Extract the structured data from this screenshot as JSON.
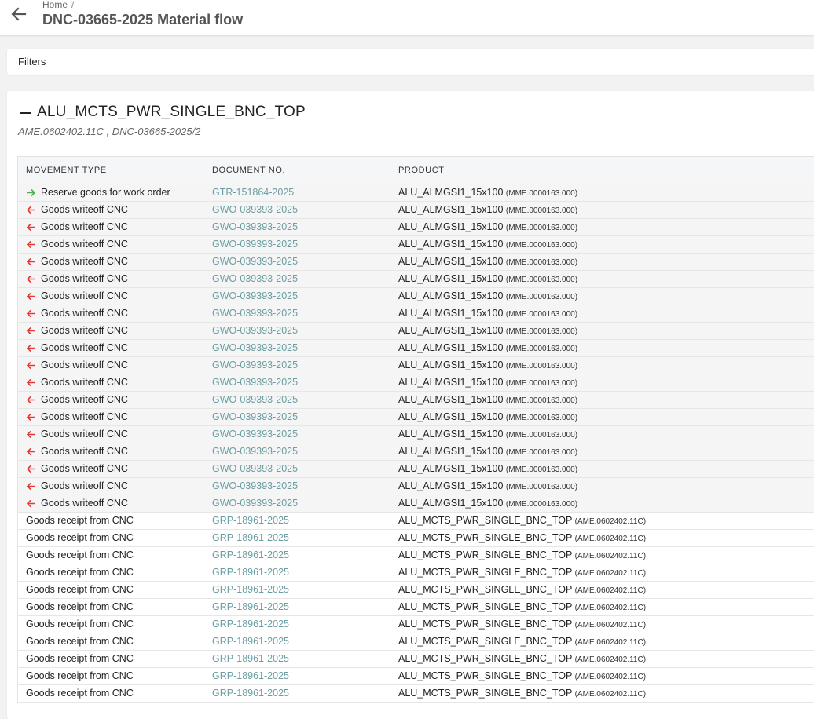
{
  "header": {
    "breadcrumb_home": "Home",
    "breadcrumb_sep": "/",
    "title": "DNC-03665-2025 Material flow"
  },
  "filters": {
    "label": "Filters"
  },
  "group": {
    "title": "ALU_MCTS_PWR_SINGLE_BNC_TOP",
    "subtitle": "AME.0602402.11C , DNC-03665-2025/2"
  },
  "colors": {
    "arrow_in": "#4caf50",
    "arrow_out": "#e53935",
    "link": "#6b9ea3"
  },
  "table": {
    "columns": [
      "MOVEMENT TYPE",
      "DOCUMENT NO.",
      "PRODUCT"
    ],
    "rows": [
      {
        "icon": "arrow-right-icon",
        "type": "Reserve goods for work order",
        "doc": "GTR-151864-2025",
        "product": "ALU_ALMGSI1_15x100",
        "code": "(MME.0000163.000)"
      },
      {
        "icon": "arrow-left-icon",
        "type": "Goods writeoff CNC",
        "doc": "GWO-039393-2025",
        "product": "ALU_ALMGSI1_15x100",
        "code": "(MME.0000163.000)"
      },
      {
        "icon": "arrow-left-icon",
        "type": "Goods writeoff CNC",
        "doc": "GWO-039393-2025",
        "product": "ALU_ALMGSI1_15x100",
        "code": "(MME.0000163.000)"
      },
      {
        "icon": "arrow-left-icon",
        "type": "Goods writeoff CNC",
        "doc": "GWO-039393-2025",
        "product": "ALU_ALMGSI1_15x100",
        "code": "(MME.0000163.000)"
      },
      {
        "icon": "arrow-left-icon",
        "type": "Goods writeoff CNC",
        "doc": "GWO-039393-2025",
        "product": "ALU_ALMGSI1_15x100",
        "code": "(MME.0000163.000)"
      },
      {
        "icon": "arrow-left-icon",
        "type": "Goods writeoff CNC",
        "doc": "GWO-039393-2025",
        "product": "ALU_ALMGSI1_15x100",
        "code": "(MME.0000163.000)"
      },
      {
        "icon": "arrow-left-icon",
        "type": "Goods writeoff CNC",
        "doc": "GWO-039393-2025",
        "product": "ALU_ALMGSI1_15x100",
        "code": "(MME.0000163.000)"
      },
      {
        "icon": "arrow-left-icon",
        "type": "Goods writeoff CNC",
        "doc": "GWO-039393-2025",
        "product": "ALU_ALMGSI1_15x100",
        "code": "(MME.0000163.000)"
      },
      {
        "icon": "arrow-left-icon",
        "type": "Goods writeoff CNC",
        "doc": "GWO-039393-2025",
        "product": "ALU_ALMGSI1_15x100",
        "code": "(MME.0000163.000)"
      },
      {
        "icon": "arrow-left-icon",
        "type": "Goods writeoff CNC",
        "doc": "GWO-039393-2025",
        "product": "ALU_ALMGSI1_15x100",
        "code": "(MME.0000163.000)"
      },
      {
        "icon": "arrow-left-icon",
        "type": "Goods writeoff CNC",
        "doc": "GWO-039393-2025",
        "product": "ALU_ALMGSI1_15x100",
        "code": "(MME.0000163.000)"
      },
      {
        "icon": "arrow-left-icon",
        "type": "Goods writeoff CNC",
        "doc": "GWO-039393-2025",
        "product": "ALU_ALMGSI1_15x100",
        "code": "(MME.0000163.000)"
      },
      {
        "icon": "arrow-left-icon",
        "type": "Goods writeoff CNC",
        "doc": "GWO-039393-2025",
        "product": "ALU_ALMGSI1_15x100",
        "code": "(MME.0000163.000)"
      },
      {
        "icon": "arrow-left-icon",
        "type": "Goods writeoff CNC",
        "doc": "GWO-039393-2025",
        "product": "ALU_ALMGSI1_15x100",
        "code": "(MME.0000163.000)"
      },
      {
        "icon": "arrow-left-icon",
        "type": "Goods writeoff CNC",
        "doc": "GWO-039393-2025",
        "product": "ALU_ALMGSI1_15x100",
        "code": "(MME.0000163.000)"
      },
      {
        "icon": "arrow-left-icon",
        "type": "Goods writeoff CNC",
        "doc": "GWO-039393-2025",
        "product": "ALU_ALMGSI1_15x100",
        "code": "(MME.0000163.000)"
      },
      {
        "icon": "arrow-left-icon",
        "type": "Goods writeoff CNC",
        "doc": "GWO-039393-2025",
        "product": "ALU_ALMGSI1_15x100",
        "code": "(MME.0000163.000)"
      },
      {
        "icon": "arrow-left-icon",
        "type": "Goods writeoff CNC",
        "doc": "GWO-039393-2025",
        "product": "ALU_ALMGSI1_15x100",
        "code": "(MME.0000163.000)"
      },
      {
        "icon": "arrow-left-icon",
        "type": "Goods writeoff CNC",
        "doc": "GWO-039393-2025",
        "product": "ALU_ALMGSI1_15x100",
        "code": "(MME.0000163.000)"
      },
      {
        "icon": "",
        "type": "Goods receipt from CNC",
        "doc": "GRP-18961-2025",
        "product": "ALU_MCTS_PWR_SINGLE_BNC_TOP",
        "code": "(AME.0602402.11C)"
      },
      {
        "icon": "",
        "type": "Goods receipt from CNC",
        "doc": "GRP-18961-2025",
        "product": "ALU_MCTS_PWR_SINGLE_BNC_TOP",
        "code": "(AME.0602402.11C)"
      },
      {
        "icon": "",
        "type": "Goods receipt from CNC",
        "doc": "GRP-18961-2025",
        "product": "ALU_MCTS_PWR_SINGLE_BNC_TOP",
        "code": "(AME.0602402.11C)"
      },
      {
        "icon": "",
        "type": "Goods receipt from CNC",
        "doc": "GRP-18961-2025",
        "product": "ALU_MCTS_PWR_SINGLE_BNC_TOP",
        "code": "(AME.0602402.11C)"
      },
      {
        "icon": "",
        "type": "Goods receipt from CNC",
        "doc": "GRP-18961-2025",
        "product": "ALU_MCTS_PWR_SINGLE_BNC_TOP",
        "code": "(AME.0602402.11C)"
      },
      {
        "icon": "",
        "type": "Goods receipt from CNC",
        "doc": "GRP-18961-2025",
        "product": "ALU_MCTS_PWR_SINGLE_BNC_TOP",
        "code": "(AME.0602402.11C)"
      },
      {
        "icon": "",
        "type": "Goods receipt from CNC",
        "doc": "GRP-18961-2025",
        "product": "ALU_MCTS_PWR_SINGLE_BNC_TOP",
        "code": "(AME.0602402.11C)"
      },
      {
        "icon": "",
        "type": "Goods receipt from CNC",
        "doc": "GRP-18961-2025",
        "product": "ALU_MCTS_PWR_SINGLE_BNC_TOP",
        "code": "(AME.0602402.11C)"
      },
      {
        "icon": "",
        "type": "Goods receipt from CNC",
        "doc": "GRP-18961-2025",
        "product": "ALU_MCTS_PWR_SINGLE_BNC_TOP",
        "code": "(AME.0602402.11C)"
      },
      {
        "icon": "",
        "type": "Goods receipt from CNC",
        "doc": "GRP-18961-2025",
        "product": "ALU_MCTS_PWR_SINGLE_BNC_TOP",
        "code": "(AME.0602402.11C)"
      },
      {
        "icon": "",
        "type": "Goods receipt from CNC",
        "doc": "GRP-18961-2025",
        "product": "ALU_MCTS_PWR_SINGLE_BNC_TOP",
        "code": "(AME.0602402.11C)"
      }
    ]
  }
}
